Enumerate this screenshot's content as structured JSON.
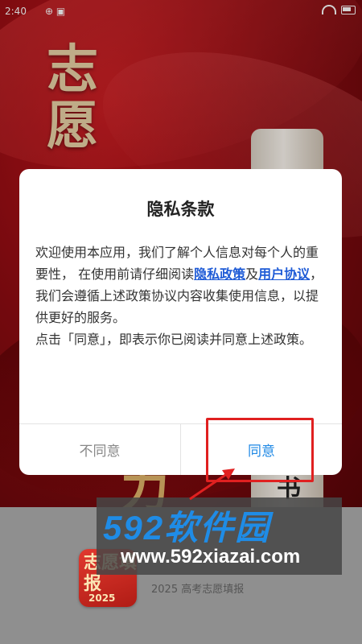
{
  "status_bar": {
    "time": "2:40",
    "misc": "⊕ ▣"
  },
  "background": {
    "calligraphy": "志愿",
    "scroll_char": "书",
    "swirl_char": "力"
  },
  "dialog": {
    "title": "隐私条款",
    "body_part1": "欢迎使用本应用，我们了解个人信息对每个人的重要性， 在使用前请仔细阅读",
    "privacy_link": "隐私政策",
    "body_part2": "及",
    "user_link": "用户协议",
    "body_part3": "， 我们会遵循上述政策协议内容收集使用信息，以提供更好的服务。",
    "body_part4": "点击「同意」，即表示你已阅读并同意上述政策。",
    "disagree_label": "不同意",
    "agree_label": "同意"
  },
  "app": {
    "logo_text": "志愿填报",
    "logo_year": "2025",
    "caption": "2025 高考志愿填报"
  },
  "watermark": {
    "title": "592软件园",
    "url": "www.592xiazai.com"
  },
  "colors": {
    "accent_blue": "#1e88e5",
    "link_blue": "#1e5bd6",
    "annotation_red": "#e02020",
    "splash_red": "#8e0c12"
  }
}
